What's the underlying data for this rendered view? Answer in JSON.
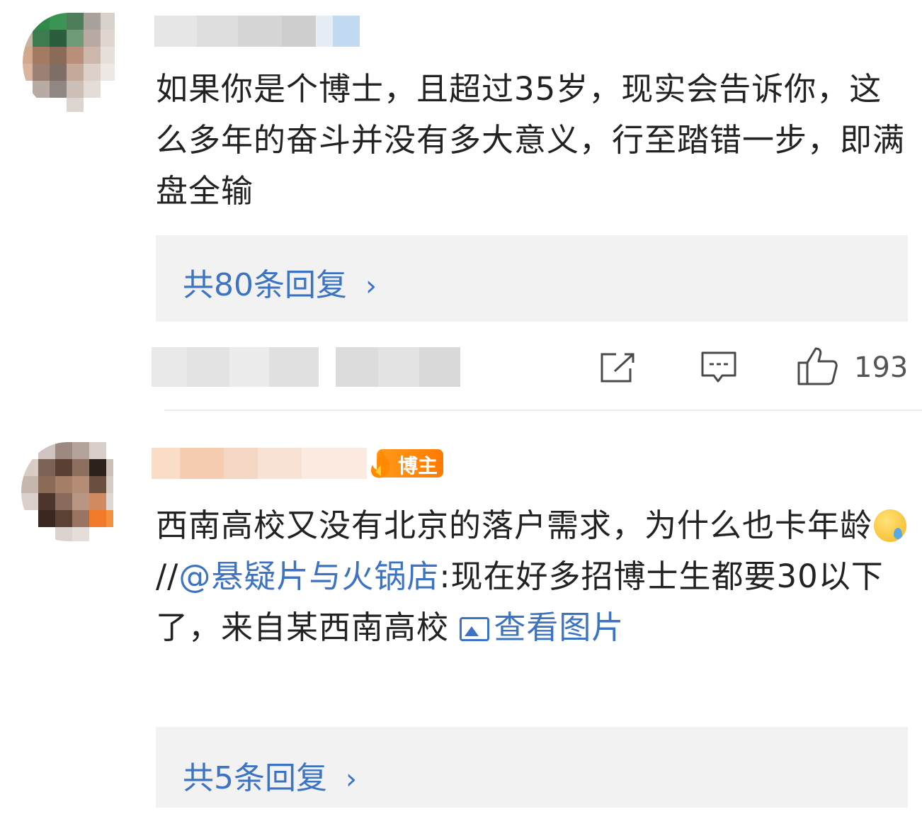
{
  "comments": [
    {
      "text": "如果你是个博士，且超过35岁，现实会告诉你，这么多年的奋斗并没有多大意义，行至踏错一步，即满盘全输",
      "replies_label": "共80条回复",
      "like_count": "193"
    },
    {
      "badge": "博主",
      "text_main": "西南高校又没有北京的落户需求，为什么也卡年龄",
      "text_sep": "//",
      "mention": "@悬疑片与火锅店",
      "text_rest": ":现在好多招博士生都要30以下了，来自某西南高校 ",
      "view_image_label": "查看图片",
      "replies_label": "共5条回复"
    }
  ],
  "icons": {
    "chevron": "chevron-right-icon",
    "share": "share-icon",
    "comment": "comment-icon",
    "like": "thumbs-up-icon",
    "image": "image-icon",
    "emoji": "crying-emoji-icon"
  },
  "colors": {
    "link": "#3c73c3",
    "reply_bg": "#f2f2f2",
    "badge": "#ff8a00"
  }
}
